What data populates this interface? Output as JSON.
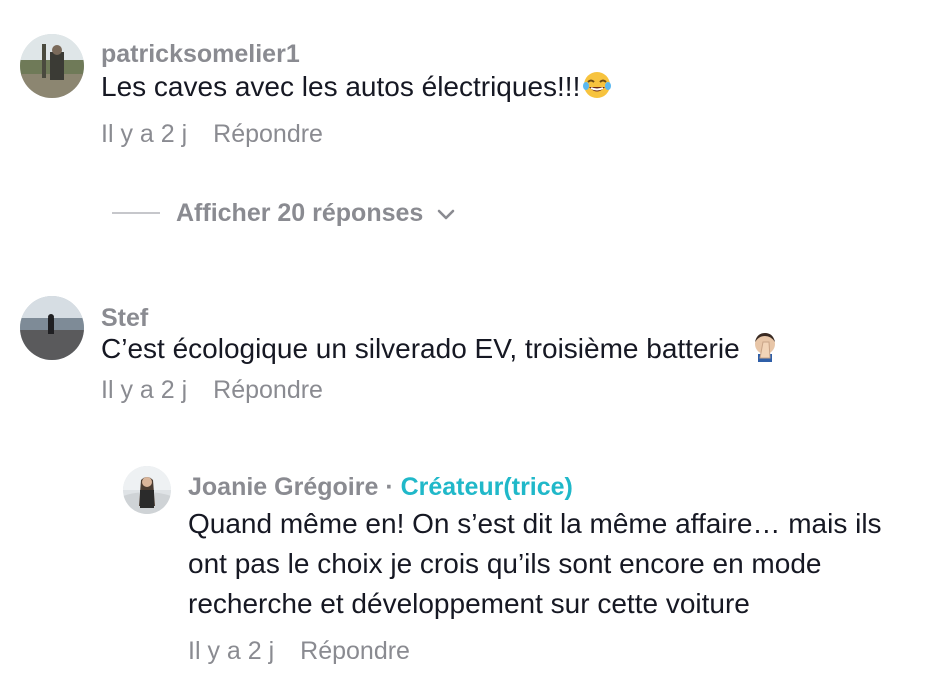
{
  "comments": [
    {
      "username": "patricksomelier1",
      "text": "Les caves avec les autos électriques!!!",
      "emoji": "joy-emoji",
      "time": "Il y a 2 j",
      "reply_label": "Répondre",
      "replies_toggle": "Afficher 20 réponses"
    },
    {
      "username": "Stef",
      "text": "C’est écologique un silverado EV, troisième batterie",
      "emoji": "facepalm-emoji",
      "time": "Il y a 2 j",
      "reply_label": "Répondre",
      "reply": {
        "username": "Joanie Grégoire",
        "separator": "·",
        "badge": "Créateur(trice)",
        "text": "Quand même en! On s’est dit la même affaire… mais ils ont pas le choix je crois qu’ils sont encore en mode recherche et développement sur cette voiture",
        "time": "Il y a 2 j",
        "reply_label": "Répondre"
      }
    }
  ],
  "colors": {
    "username": "#8a8b91",
    "text": "#161823",
    "creator_badge": "#20b8c9",
    "meta": "#8a8b91"
  }
}
